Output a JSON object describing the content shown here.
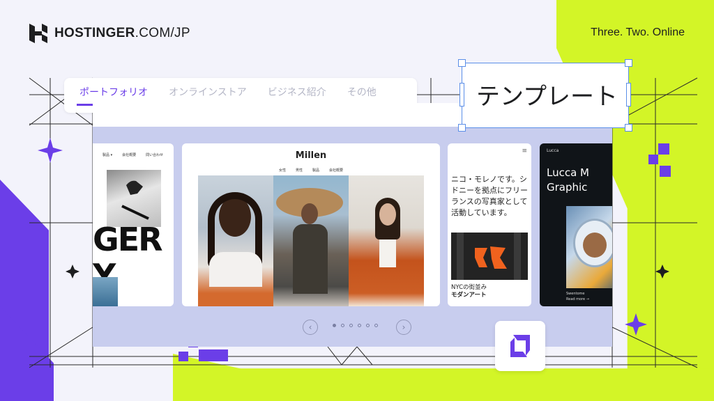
{
  "brand": {
    "name": "HOSTINGER",
    "domain_suffix": ".COM/JP",
    "tagline": "Three. Two. Online"
  },
  "tabs": [
    {
      "label": "ポートフォリオ",
      "active": true
    },
    {
      "label": "オンラインストア",
      "active": false
    },
    {
      "label": "ビジネス紹介",
      "active": false
    },
    {
      "label": "その他",
      "active": false
    }
  ],
  "template_label": "テンプレート",
  "cards": {
    "card1": {
      "nav": [
        "製品 ▾",
        "会社概要",
        "問い合わせ"
      ],
      "big_text_line1": "GER",
      "big_text_line2": "Y"
    },
    "card2": {
      "title": "Millen",
      "nav": [
        "女性",
        "男性",
        "製品",
        "会社概要"
      ]
    },
    "card3": {
      "body": "ニコ・モレノです。シドニーを拠点にフリーランスの写真家として活動しています。",
      "caption1": "NYCの街並み",
      "caption2": "モダンアート"
    },
    "card4": {
      "small": "Lucca",
      "heading_line1": "Lucca M",
      "heading_line2": "Graphic",
      "foot1": "Swentome",
      "foot2": "Read more →"
    }
  },
  "carousel": {
    "dot_count": 6,
    "active_dot": 1
  },
  "colors": {
    "accent": "#6b3ee8",
    "lime": "#d3f527",
    "carousel_bg": "#c8cdee",
    "selection": "#5a8ee8"
  }
}
